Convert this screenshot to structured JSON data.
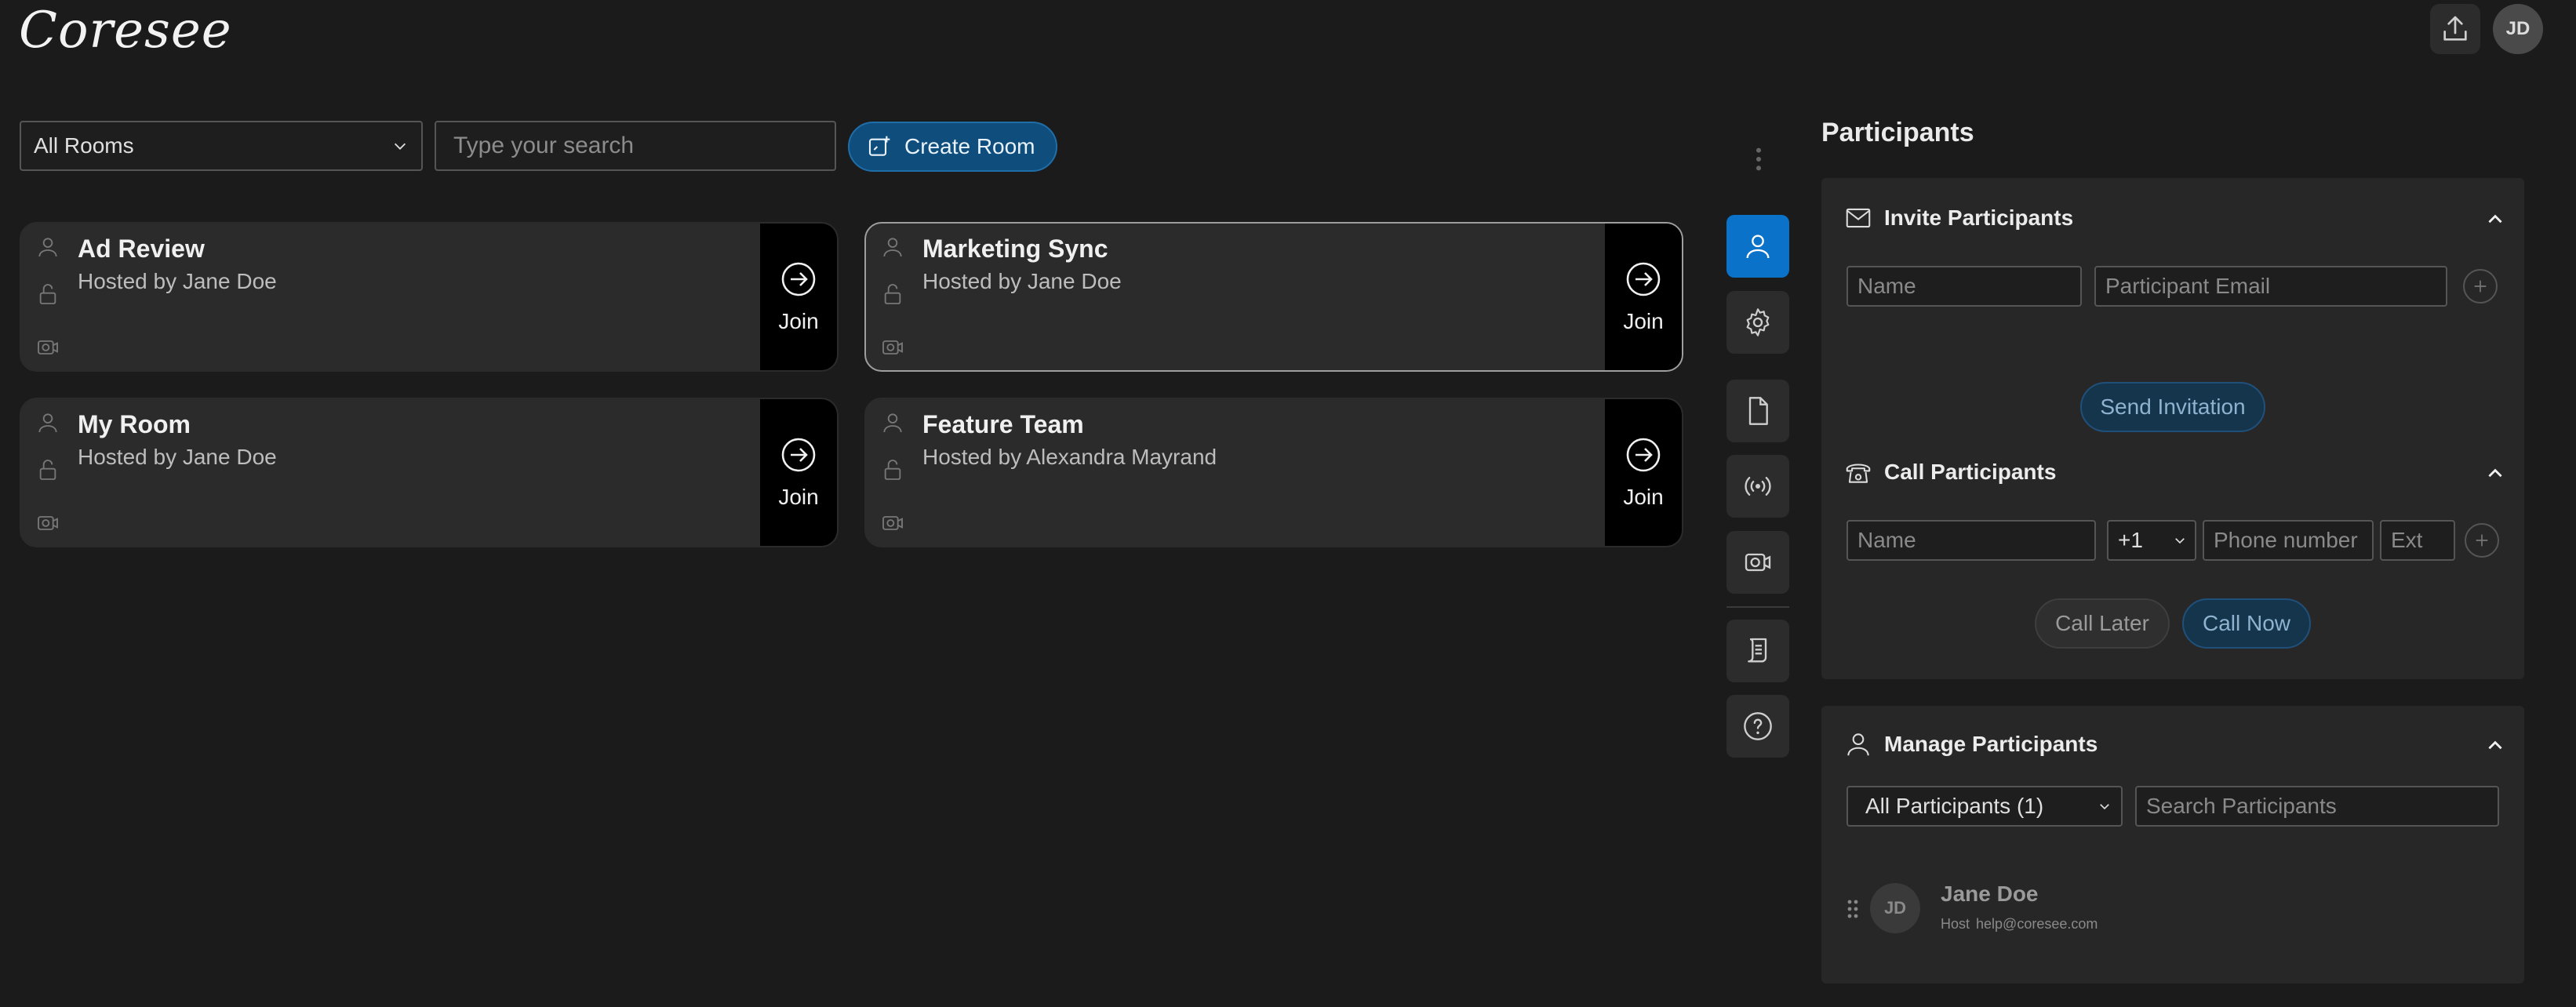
{
  "app": {
    "logo": "Coresee",
    "avatar_initials": "JD"
  },
  "toolbar": {
    "room_filter": "All Rooms",
    "search_placeholder": "Type your search",
    "create_room_label": "Create Room"
  },
  "rooms": [
    {
      "title": "Ad Review",
      "host": "Hosted by Jane Doe",
      "join_label": "Join",
      "selected": false
    },
    {
      "title": "Marketing Sync",
      "host": "Hosted by Jane Doe",
      "join_label": "Join",
      "selected": true
    },
    {
      "title": "My Room",
      "host": "Hosted by Jane Doe",
      "join_label": "Join",
      "selected": false
    },
    {
      "title": "Feature Team",
      "host": "Hosted by Alexandra Mayrand",
      "join_label": "Join",
      "selected": false
    }
  ],
  "side_toolbar": {
    "items": [
      "participants-icon",
      "settings-icon",
      "document-icon",
      "broadcast-icon",
      "camera-icon",
      "script-icon",
      "help-icon"
    ],
    "active": "participants-icon"
  },
  "participants_panel": {
    "title": "Participants",
    "invite": {
      "heading": "Invite Participants",
      "name_placeholder": "Name",
      "email_placeholder": "Participant Email",
      "send_label": "Send Invitation"
    },
    "call": {
      "heading": "Call Participants",
      "name_placeholder": "Name",
      "country_code": "+1",
      "phone_placeholder": "Phone number",
      "ext_placeholder": "Ext",
      "call_later_label": "Call Later",
      "call_now_label": "Call Now"
    },
    "manage": {
      "heading": "Manage Participants",
      "filter": "All Participants (1)",
      "search_placeholder": "Search Participants",
      "participants": [
        {
          "initials": "JD",
          "name": "Jane Doe",
          "role": "Host",
          "email": "help@coresee.com"
        }
      ]
    }
  },
  "colors": {
    "background": "#1b1b1b",
    "accent": "#0a72c8",
    "create_button": "#0e4d7c"
  }
}
